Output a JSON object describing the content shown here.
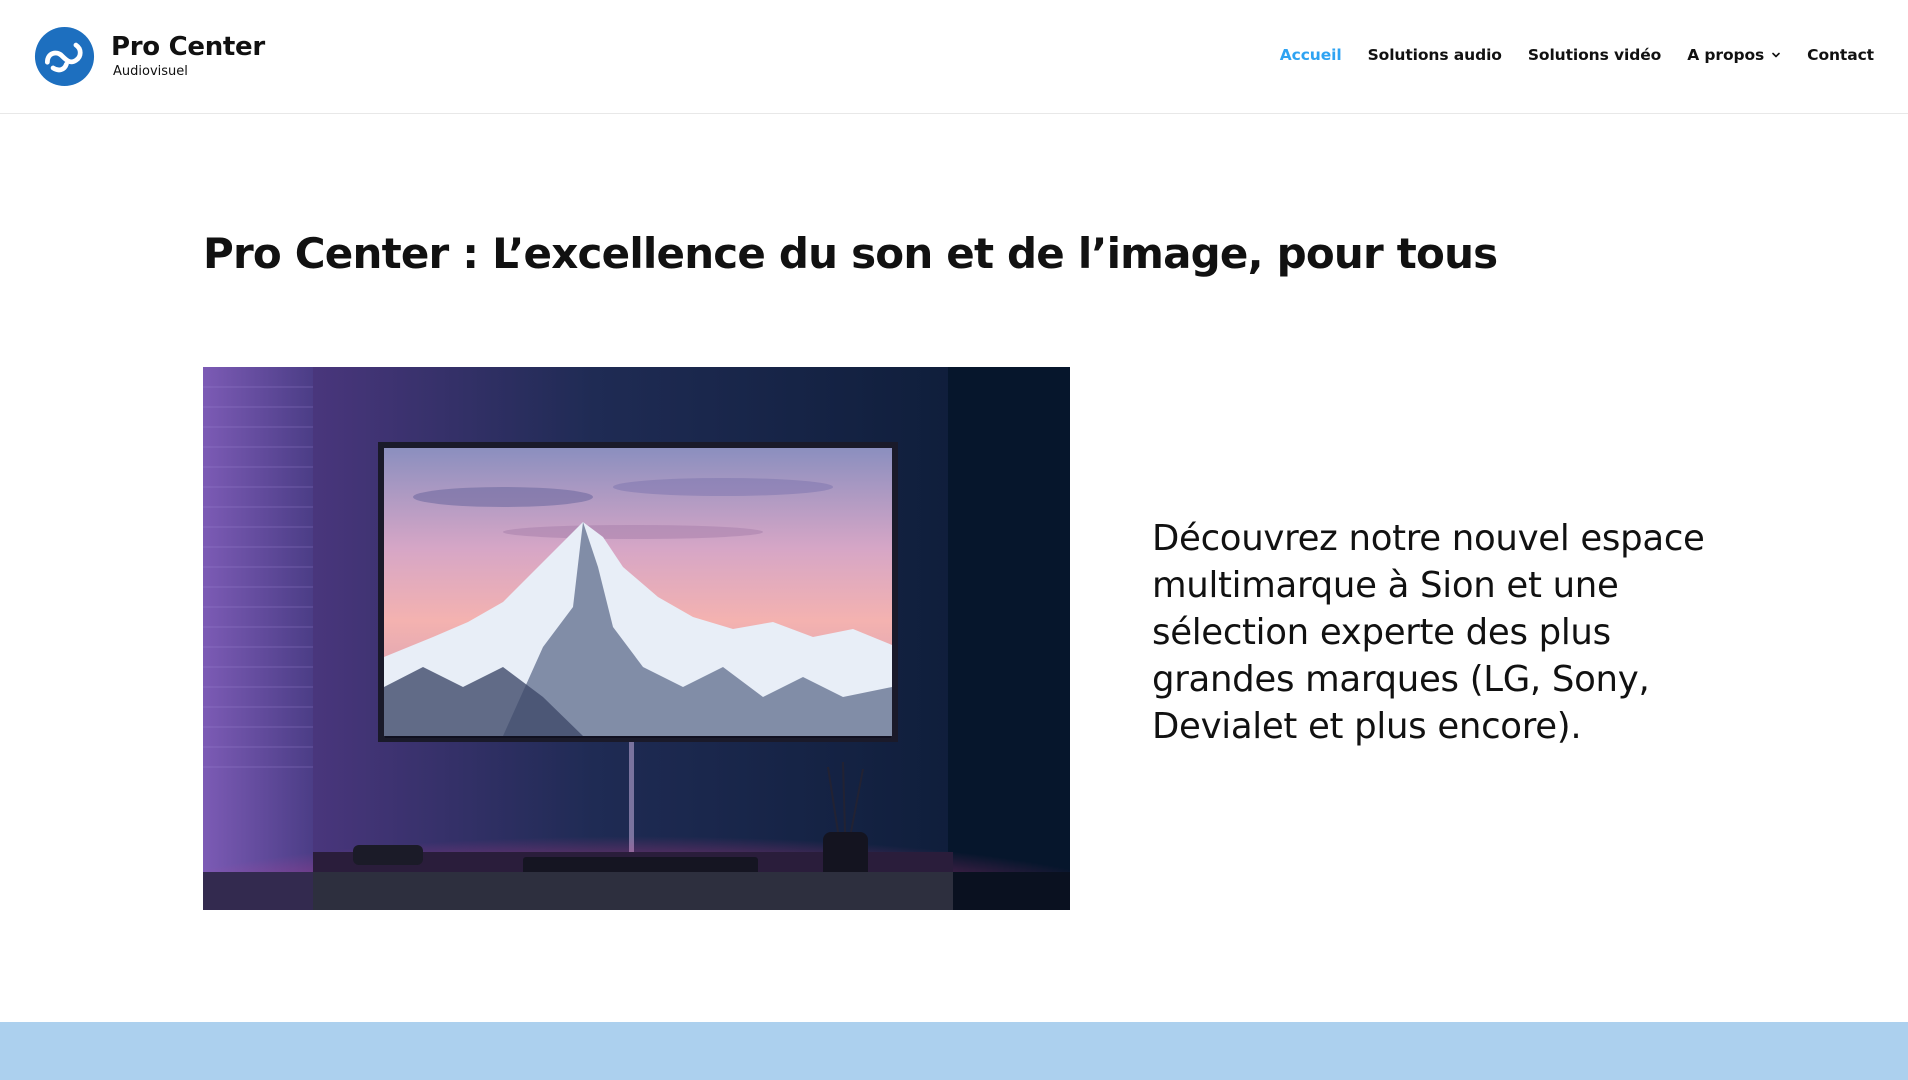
{
  "brand": {
    "name": "Pro Center",
    "tagline": "Audiovisuel",
    "accent": "#2ea3f2",
    "logo_color": "#1d6fbf"
  },
  "nav": {
    "items": [
      {
        "label": "Accueil",
        "active": true
      },
      {
        "label": "Solutions audio",
        "active": false
      },
      {
        "label": "Solutions vidéo",
        "active": false
      },
      {
        "label": "A propos",
        "active": false,
        "has_dropdown": true,
        "icon": "chevron-down-icon"
      },
      {
        "label": "Contact",
        "active": false
      }
    ]
  },
  "main": {
    "title": "Pro Center : L’excellence du son et de l’image, pour tous",
    "hero_image": {
      "icon": "tv-living-room-photo"
    },
    "intro_text": "Découvrez notre nouvel espace multimarque à Sion et une sélection experte des plus grandes marques (LG, Sony, Devialet et plus encore)."
  },
  "band": {
    "color": "#acd0ee"
  }
}
